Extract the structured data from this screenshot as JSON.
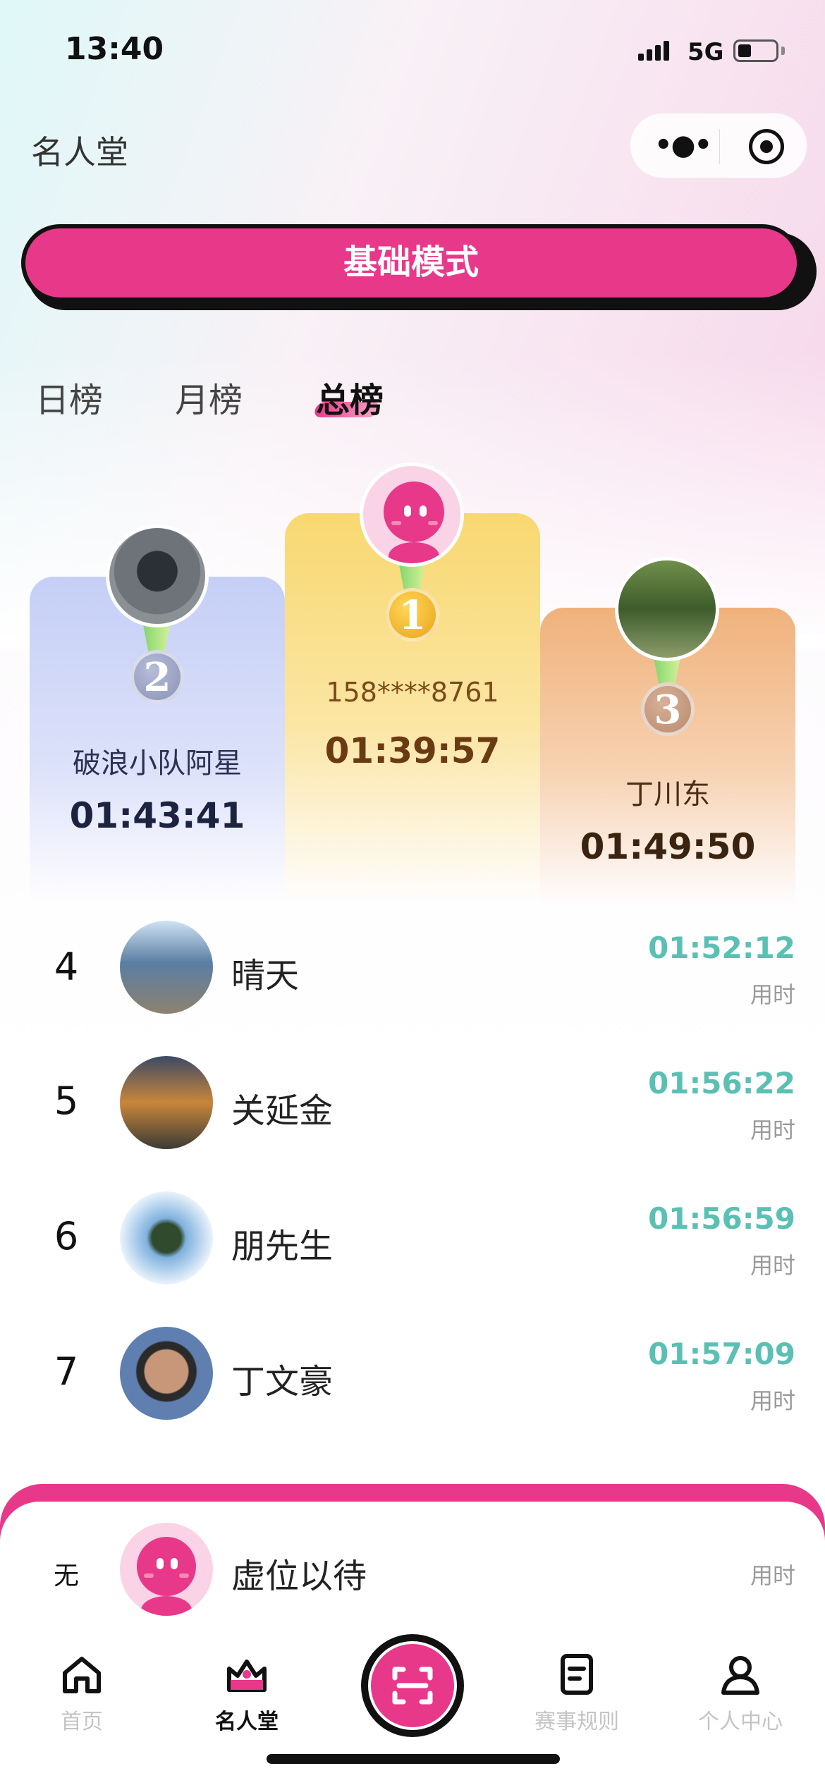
{
  "status_bar": {
    "time": "13:40",
    "network": "5G"
  },
  "nav": {
    "title": "名人堂"
  },
  "mode_button": {
    "label": "基础模式"
  },
  "tabs": [
    {
      "label": "日榜",
      "active": false
    },
    {
      "label": "月榜",
      "active": false
    },
    {
      "label": "总榜",
      "active": true
    }
  ],
  "podium": [
    {
      "rank": "1",
      "name": "158****8761",
      "time": "01:39:57",
      "avatar": "default-pink-avatar"
    },
    {
      "rank": "2",
      "name": "破浪小队阿星",
      "time": "01:43:41",
      "avatar": "photo"
    },
    {
      "rank": "3",
      "name": "丁川东",
      "time": "01:49:50",
      "avatar": "photo"
    }
  ],
  "list": [
    {
      "rank": "4",
      "name": "晴天",
      "time": "01:52:12",
      "sub": "用时"
    },
    {
      "rank": "5",
      "name": "关延金",
      "time": "01:56:22",
      "sub": "用时"
    },
    {
      "rank": "6",
      "name": "朋先生",
      "time": "01:56:59",
      "sub": "用时"
    },
    {
      "rank": "7",
      "name": "丁文豪",
      "time": "01:57:09",
      "sub": "用时"
    }
  ],
  "me": {
    "rank": "无",
    "name": "虚位以待",
    "sub": "用时"
  },
  "tabbar": [
    {
      "label": "首页",
      "icon": "home-icon",
      "active": false
    },
    {
      "label": "名人堂",
      "icon": "hall-of-fame-icon",
      "active": true
    },
    {
      "label": "",
      "icon": "scan-icon",
      "active": false
    },
    {
      "label": "赛事规则",
      "icon": "rules-icon",
      "active": false
    },
    {
      "label": "个人中心",
      "icon": "profile-icon",
      "active": false
    }
  ],
  "colors": {
    "accent": "#e8388a",
    "time_green": "#5bc0b4",
    "gold": "#f8d871",
    "silver": "#c5cff6",
    "bronze": "#f0b27c"
  }
}
